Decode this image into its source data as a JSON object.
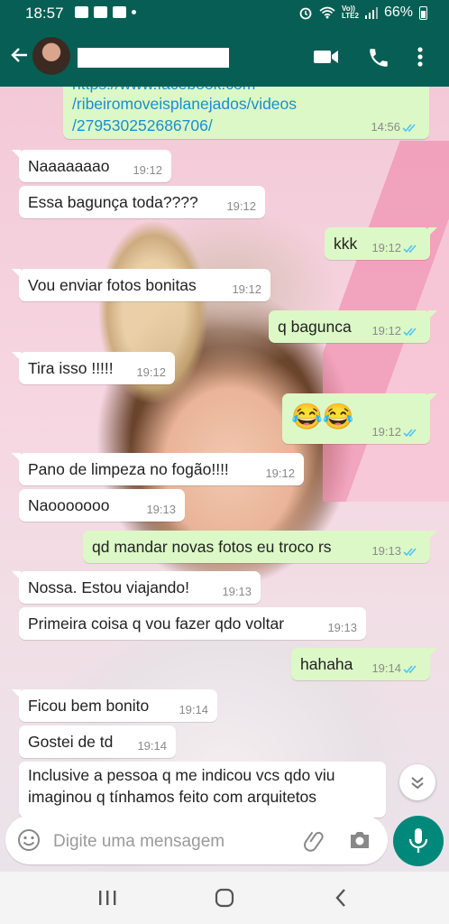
{
  "status_bar": {
    "time": "18:57",
    "network_top": "Vo))",
    "network_bottom": "LTE2",
    "battery": "66%"
  },
  "header": {
    "contact_name": "",
    "icons": [
      "back-arrow-icon",
      "video-call-icon",
      "phone-icon",
      "more-vertical-icon"
    ]
  },
  "colors": {
    "header": "#075e54",
    "outgoing_bubble": "#dcf8c6",
    "incoming_bubble": "#ffffff",
    "read_ticks": "#4fc3f7",
    "mic_button": "#00897b"
  },
  "messages": [
    {
      "dir": "out",
      "lines": [
        "https://www.facebook.com",
        "/ribeiromoveisplanejados/videos",
        "/279530252686706/"
      ],
      "time": "14:56",
      "read": true
    },
    {
      "dir": "in",
      "text": "Naaaaaaao",
      "time": "19:12"
    },
    {
      "dir": "in",
      "text": "Essa bagunça toda????",
      "time": "19:12"
    },
    {
      "dir": "out",
      "text": "kkk",
      "time": "19:12",
      "read": true
    },
    {
      "dir": "in",
      "text": "Vou enviar fotos bonitas",
      "time": "19:12"
    },
    {
      "dir": "out",
      "text": "q bagunca",
      "time": "19:12",
      "read": true
    },
    {
      "dir": "in",
      "text": "Tira isso !!!!!",
      "time": "19:12"
    },
    {
      "dir": "out",
      "text": "😂😂",
      "time": "19:12",
      "read": true
    },
    {
      "dir": "in",
      "text": "Pano de limpeza no fogão!!!!",
      "time": "19:12"
    },
    {
      "dir": "in",
      "text": "Naooooooo",
      "time": "19:13"
    },
    {
      "dir": "out",
      "text": "qd mandar novas fotos eu troco rs",
      "time": "19:13",
      "read": true
    },
    {
      "dir": "in",
      "text": "Nossa. Estou viajando!",
      "time": "19:13"
    },
    {
      "dir": "in",
      "text": "Primeira coisa q vou fazer qdo voltar",
      "time": "19:13"
    },
    {
      "dir": "out",
      "text": "hahaha",
      "time": "19:14",
      "read": true
    },
    {
      "dir": "in",
      "text": "Ficou bem bonito",
      "time": "19:14"
    },
    {
      "dir": "in",
      "text": "Gostei de td",
      "time": "19:14"
    },
    {
      "dir": "in",
      "lines": [
        "Inclusive a pessoa q me indicou vcs qdo viu",
        "imaginou q tínhamos feito com arquitetos"
      ],
      "time": ""
    }
  ],
  "input": {
    "placeholder": "Digite uma mensagem"
  },
  "nav_bar": {
    "buttons": [
      "recent-apps-icon",
      "home-icon",
      "back-icon"
    ]
  }
}
